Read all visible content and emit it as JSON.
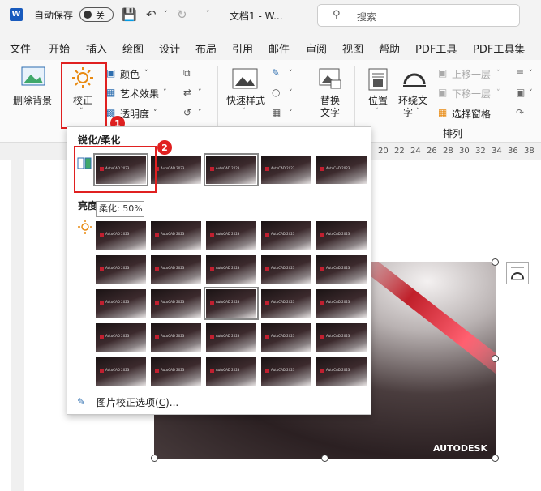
{
  "titlebar": {
    "autosave_label": "自动保存",
    "autosave_state": "关",
    "doc_title": "文档1 - W...",
    "search_placeholder": "搜索"
  },
  "menu": [
    "文件",
    "开始",
    "插入",
    "绘图",
    "设计",
    "布局",
    "引用",
    "邮件",
    "审阅",
    "视图",
    "帮助",
    "PDF工具",
    "PDF工具集"
  ],
  "ribbon": {
    "remove_bg": "删除背景",
    "corrections": "校正",
    "color": "颜色",
    "artistic": "艺术效果",
    "transparency": "透明度",
    "quick_styles": "快速样式",
    "alt_text_line1": "替换",
    "alt_text_line2": "文字",
    "position": "位置",
    "wrap_text_line1": "环绕文",
    "wrap_text_line2": "字",
    "bring_forward": "上移一层",
    "send_backward": "下移一层",
    "selection_pane": "选择窗格",
    "arrange_group": "排列"
  },
  "badges": {
    "one": "1",
    "two": "2"
  },
  "ruler_numbers": [
    "20",
    "22",
    "24",
    "26",
    "28",
    "30",
    "32",
    "34",
    "36",
    "38"
  ],
  "dropdown": {
    "sharpen_heading": "锐化/柔化",
    "brightness_heading": "亮度",
    "tooltip": "柔化: 50%",
    "footer_prefix": "图片校正选项(",
    "footer_key": "C",
    "footer_suffix": ")...",
    "thumb_caption": "AutoCAD 2023"
  },
  "doc_image": {
    "brand": "AUTODESK"
  },
  "colors": {
    "accent_red": "#e02020",
    "word_blue": "#185abd"
  }
}
